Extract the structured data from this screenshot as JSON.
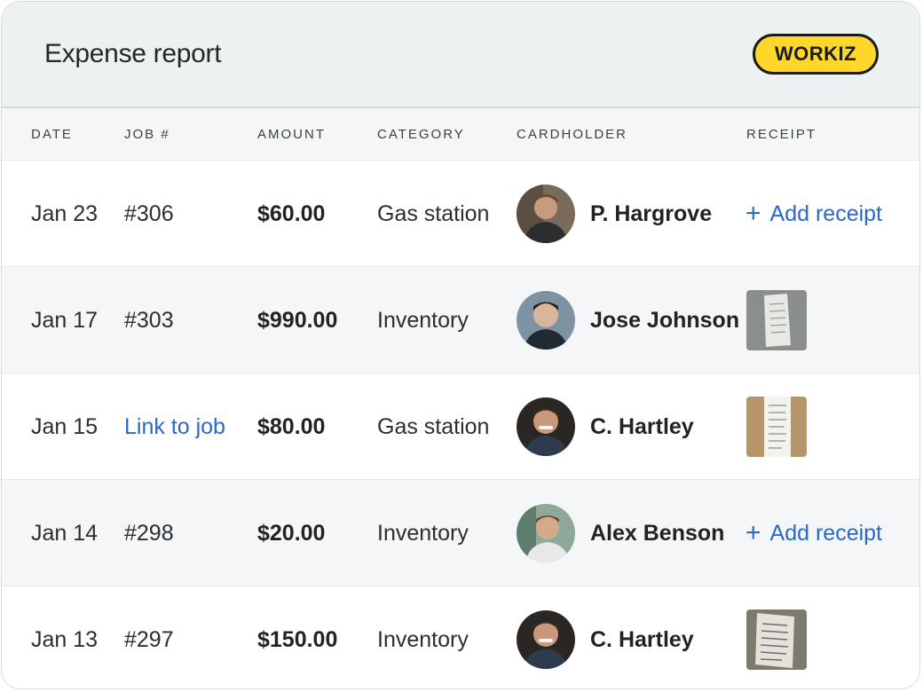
{
  "header": {
    "title": "Expense report",
    "logo_text": "WORKIZ"
  },
  "columns": [
    "DATE",
    "JOB #",
    "AMOUNT",
    "CATEGORY",
    "CARDHOLDER",
    "RECEIPT"
  ],
  "rows": [
    {
      "date": "Jan 23",
      "job": "#306",
      "job_is_link": false,
      "amount": "$60.00",
      "category": "Gas station",
      "cardholder": "P. Hargrove",
      "receipt": "+ Add receipt",
      "receipt_state": "add"
    },
    {
      "date": "Jan 17",
      "job": "#303",
      "job_is_link": false,
      "amount": "$990.00",
      "category": "Inventory",
      "cardholder": "Jose Johnson",
      "receipt": "",
      "receipt_state": "image"
    },
    {
      "date": "Jan 15",
      "job": "Link to job",
      "job_is_link": true,
      "amount": "$80.00",
      "category": "Gas station",
      "cardholder": "C. Hartley",
      "receipt": "",
      "receipt_state": "image"
    },
    {
      "date": "Jan 14",
      "job": "#298",
      "job_is_link": false,
      "amount": "$20.00",
      "category": "Inventory",
      "cardholder": "Alex Benson",
      "receipt": "+ Add receipt",
      "receipt_state": "add"
    },
    {
      "date": "Jan 13",
      "job": "#297",
      "job_is_link": false,
      "amount": "$150.00",
      "category": "Inventory",
      "cardholder": "C. Hartley",
      "receipt": "",
      "receipt_state": "image"
    }
  ],
  "add_receipt_label": "Add receipt",
  "colors": {
    "link": "#2c68c9",
    "logo_bg": "#ffd72a",
    "header_bg": "#edf1f1",
    "alt_row": "#f4f6f7"
  }
}
